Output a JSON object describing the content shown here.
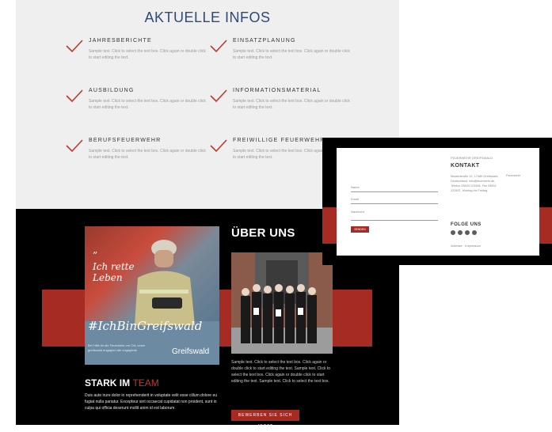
{
  "infos": {
    "title": "AKTUELLE INFOS",
    "items": [
      {
        "title": "JAHRESBERICHTE",
        "text": "Sample text. Click to select the text box. Click again or double click to start editing the text."
      },
      {
        "title": "EINSATZPLANUNG",
        "text": "Sample text. Click to select the text box. Click again or double click to start editing the text."
      },
      {
        "title": "AUSBILDUNG",
        "text": "Sample text. Click to select the text box. Click again or double click to start editing the text."
      },
      {
        "title": "INFORMATIONSMATERIAL",
        "text": "Sample text. Click to select the text box. Click again or double click to start editing the text."
      },
      {
        "title": "BERUFSFEUERWEHR",
        "text": "Sample text. Click to select the text box. Click again or double click to start editing the text."
      },
      {
        "title": "FREIWILLIGE FEUERWEHR",
        "text": "Sample text. Click to select the text box. Click again or double click to start editing the text."
      }
    ]
  },
  "poster": {
    "quote": "”\nIch rette\nLeben",
    "hashtag": "#IchBinGreifswald",
    "footnote": "Bei Hilfe ist die Feuerwehr vor Ort, unser greifswald engagiert die engagierte",
    "brand": "Greifswald"
  },
  "ueber": {
    "title": "ÜBER UNS",
    "text": "Sample text. Click to select the text box. Click again or double click to start editing the text. Sample text. Click to select the text box. Click again or double click to start editing the text. Sample text. Click to select the text box.",
    "cta": "BEWERBEN SIE SICH JETZT"
  },
  "stark": {
    "title": "STARK IM ",
    "accent": "TEAM",
    "text": "Duis aute irure dolor in reprehenderit in voluptate velit esse cillum dolore eu fugiat nulla pariatur. Excepteur sint occaecat cupidatat non proident, sunt in culpa qui officia deserunt mollit anim id est laborum."
  },
  "kontakt": {
    "small": "FEUERWEHR GREIFSWALD",
    "title": "KONTAKT",
    "lines": "Musterstraße 12, 17489 Greifswald, Deutschland. info@feuerwehr.de, Telefon 03834 123456, Fax 03834 123457, Montag bis Freitag",
    "right": "Feuerwehr",
    "field_name": "Name",
    "field_email": "Email",
    "field_message": "Nachricht",
    "send": "SENDEN",
    "follow": "FOLGE UNS",
    "foot": "Adresse · Impressum"
  },
  "colors": {
    "accent": "#a62b22",
    "heading_blue": "#2e4a7a",
    "dark": "#000000"
  }
}
